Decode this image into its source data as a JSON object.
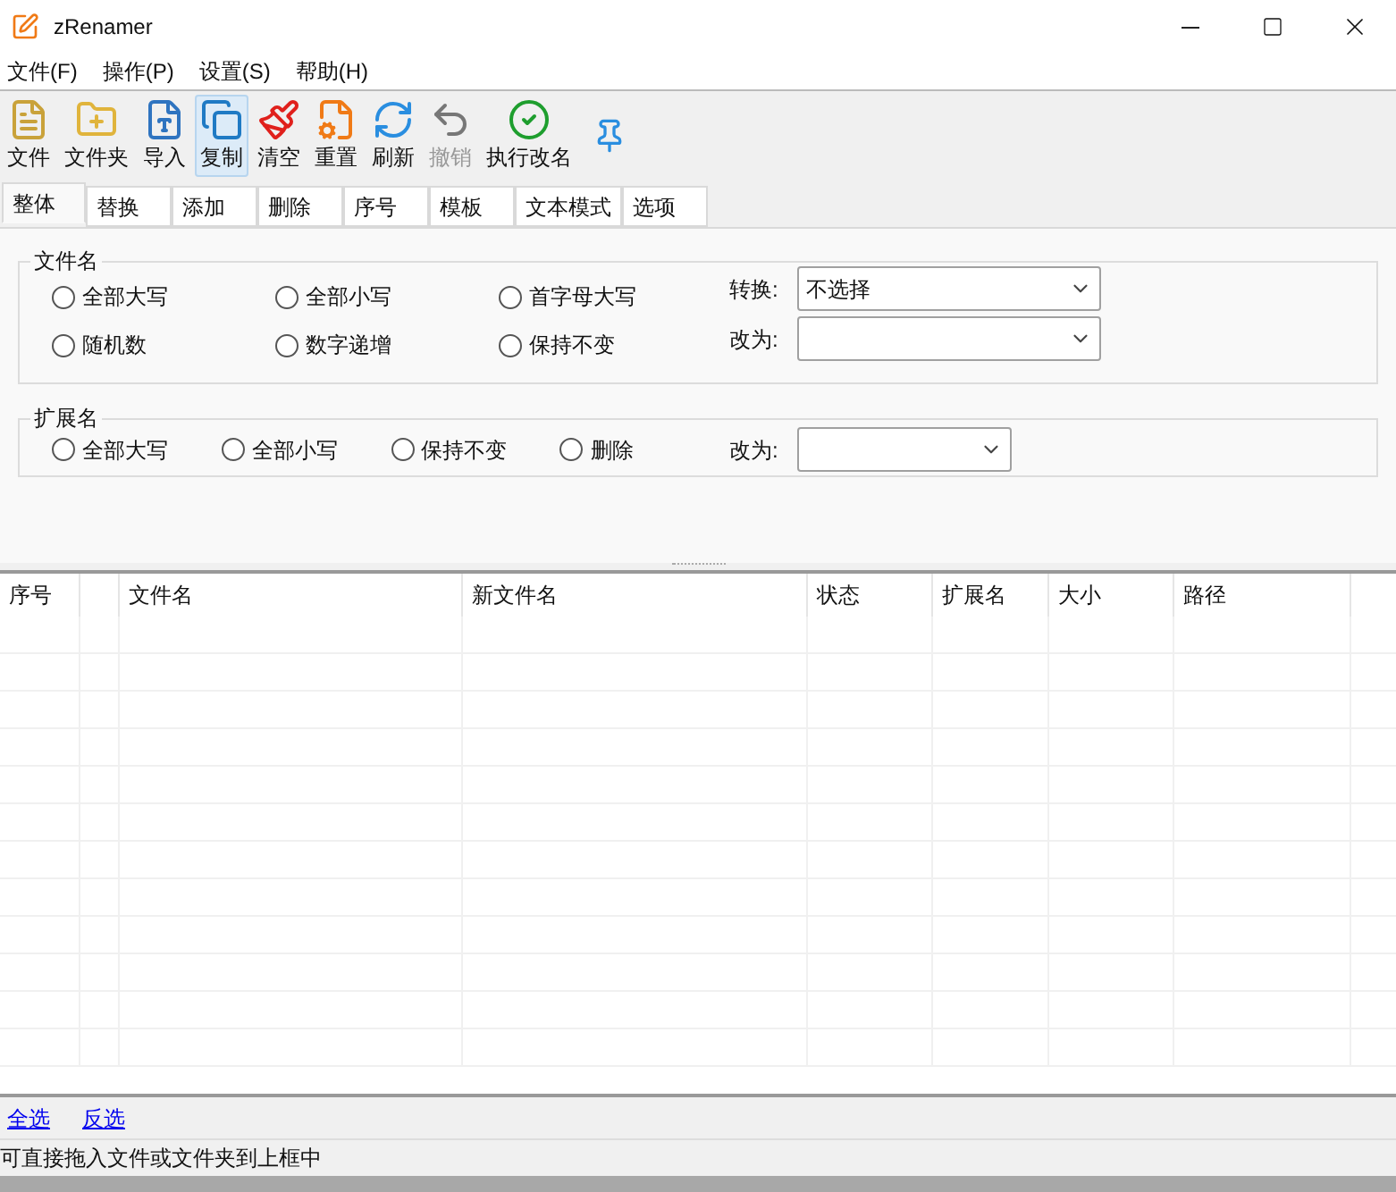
{
  "window": {
    "title": "zRenamer"
  },
  "menu": [
    "文件(F)",
    "操作(P)",
    "设置(S)",
    "帮助(H)"
  ],
  "toolbar": [
    {
      "kind": "file",
      "label": "文件",
      "selected": false,
      "disabled": false
    },
    {
      "kind": "folder",
      "label": "文件夹",
      "selected": false,
      "disabled": false
    },
    {
      "kind": "import",
      "label": "导入",
      "selected": false,
      "disabled": false
    },
    {
      "kind": "copy",
      "label": "复制",
      "selected": true,
      "disabled": false
    },
    {
      "kind": "clear",
      "label": "清空",
      "selected": false,
      "disabled": false
    },
    {
      "kind": "reset",
      "label": "重置",
      "selected": false,
      "disabled": false
    },
    {
      "kind": "refresh",
      "label": "刷新",
      "selected": false,
      "disabled": false
    },
    {
      "kind": "undo",
      "label": "撤销",
      "selected": false,
      "disabled": true
    },
    {
      "kind": "execute",
      "label": "执行改名",
      "selected": false,
      "disabled": false
    },
    {
      "kind": "pin"
    }
  ],
  "tabs": [
    {
      "label": "整体",
      "selected": true
    },
    {
      "label": "替换",
      "selected": false
    },
    {
      "label": "添加",
      "selected": false
    },
    {
      "label": "删除",
      "selected": false
    },
    {
      "label": "序号",
      "selected": false
    },
    {
      "label": "模板",
      "selected": false
    },
    {
      "label": "文本模式",
      "selected": false
    },
    {
      "label": "选项",
      "selected": false
    }
  ],
  "filename_group": {
    "title": "文件名",
    "radios": [
      {
        "label": "全部大写",
        "selected": false
      },
      {
        "label": "全部小写",
        "selected": false
      },
      {
        "label": "首字母大写",
        "selected": false
      },
      {
        "label": "随机数",
        "selected": false
      },
      {
        "label": "数字递增",
        "selected": false
      },
      {
        "label": "保持不变",
        "selected": false
      }
    ],
    "convert": {
      "label": "转换:",
      "value": "不选择"
    },
    "change_to": {
      "label": "改为:"
    }
  },
  "extension_group": {
    "title": "扩展名",
    "radios": [
      {
        "label": "全部大写",
        "selected": false
      },
      {
        "label": "全部小写",
        "selected": false
      },
      {
        "label": "保持不变",
        "selected": false
      },
      {
        "label": "删除",
        "selected": false
      }
    ],
    "change_to": {
      "label": "改为:"
    }
  },
  "table": {
    "columns": [
      "序号",
      "",
      "文件名",
      "新文件名",
      "状态",
      "扩展名",
      "大小",
      "路径"
    ]
  },
  "links": [
    "全选",
    "反选"
  ],
  "status_bar": "可直接拖入文件或文件夹到上框中"
}
